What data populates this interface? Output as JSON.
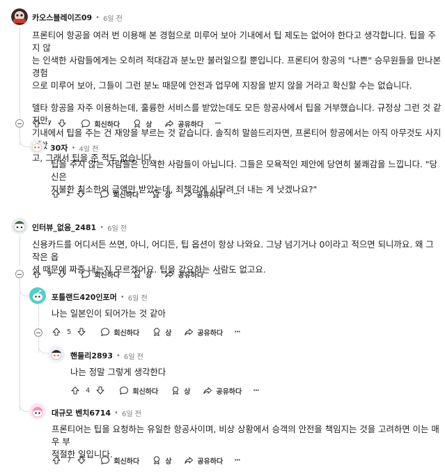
{
  "comments": {
    "c1": {
      "author": "카오스블레이즈09",
      "time": "6일 전",
      "paragraphs": [
        [
          "프론티어 항공을 여러 번 이용해 본 경험으로 미루어 보아 기내에서 팁 제도는 없어야 한다고 생각합니다. 팁을 주지 않",
          "는 인색한 사람들에게는 오히려 적대감과 분노만 불러일으킬 뿐입니다. 프론티어 항공의 \"나쁜\" 승무원들을 만나본 경험",
          "으로 미루어 보아, 그들이 그런 분노 때문에 안전과 업무에 지장을 받지 않을 거라고 확신할 수는 없습니다."
        ],
        [
          "델타 항공을 자주 이용하는데, 훌륭한 서비스를 받았는데도 모든 항공사에서 팁을 거부했습니다. 규정상 그런 것 같지만,",
          "기내에서 팁을 주는 건 재앙을 부르는 것 같습니다. 솔직히 말씀드리자면, 프론티어 항공에서는 아직 아무것도 사지 않았",
          "고, 그래서 팁을 준 적도 없습니다."
        ]
      ],
      "votes": "7",
      "reply": "회신하다",
      "award": "상",
      "share": "공유하다",
      "more": "···"
    },
    "c2": {
      "author": "30자",
      "time": "4일 전",
      "lines": [
        "팁을 주지 않는 사람들은 인색한 사람들이 아닙니다. 그들은 모욕적인 제안에 당연히 불쾌감을 느낍니다. \"당신은",
        "지불한 최소한의 금액만 받았는데, 죄책감에 시달려 더 내는 게 낫겠나요?\""
      ],
      "votes": "2",
      "reply": "회신하다",
      "award": "상",
      "share": "공유하다",
      "more": "···"
    },
    "c3": {
      "author": "인터뷰_없음_2481",
      "time": "6일 전",
      "lines": [
        "신용카드를 어디서든 쓰면, 아니, 어디든, 팁 옵션이 항상 나와요. 그냥 넘기거나 0이라고 적으면 되니까요. 왜 그 작은 옵",
        "션 때문에 짜증 내는지 모르겠어요. 팁을 강요하는 사람도 없고요."
      ],
      "votes": "9",
      "reply": "회신하다",
      "award": "상",
      "share": "공유하다",
      "more": "···"
    },
    "c4": {
      "author": "포틀랜드420인포머",
      "time": "6일 전",
      "lines": [
        "나는 일본인이 되어가는 것 같아"
      ],
      "votes": "5",
      "reply": "회신하다",
      "award": "상",
      "share": "공유하다",
      "more": "···"
    },
    "c5": {
      "author": "핸들리2893",
      "time": "6일 전",
      "lines": [
        "나는 정말 그렇게 생각한다"
      ],
      "votes": "4",
      "reply": "회신하다",
      "award": "상",
      "share": "공유하다",
      "more": "···"
    },
    "c6": {
      "author": "대규모 벤치6714",
      "time": "6일 전",
      "lines": [
        "프론티어는 팁을 요청하는 유일한 항공사이며, 비상 상황에서 승객의 안전을 책임지는 것을 고려하면 이는 매우 부",
        "적절한 일입니다."
      ],
      "votes": "7",
      "reply": "회신하다",
      "award": "상",
      "share": "공유하다",
      "more": "···"
    }
  },
  "separator_dot": "•",
  "colors": {
    "thread_line": "#dcdcdc",
    "avatar_c1": "#3b2a24",
    "avatar_c4": "#4fd0c8",
    "avatar_c6": "#ff8ab0"
  }
}
